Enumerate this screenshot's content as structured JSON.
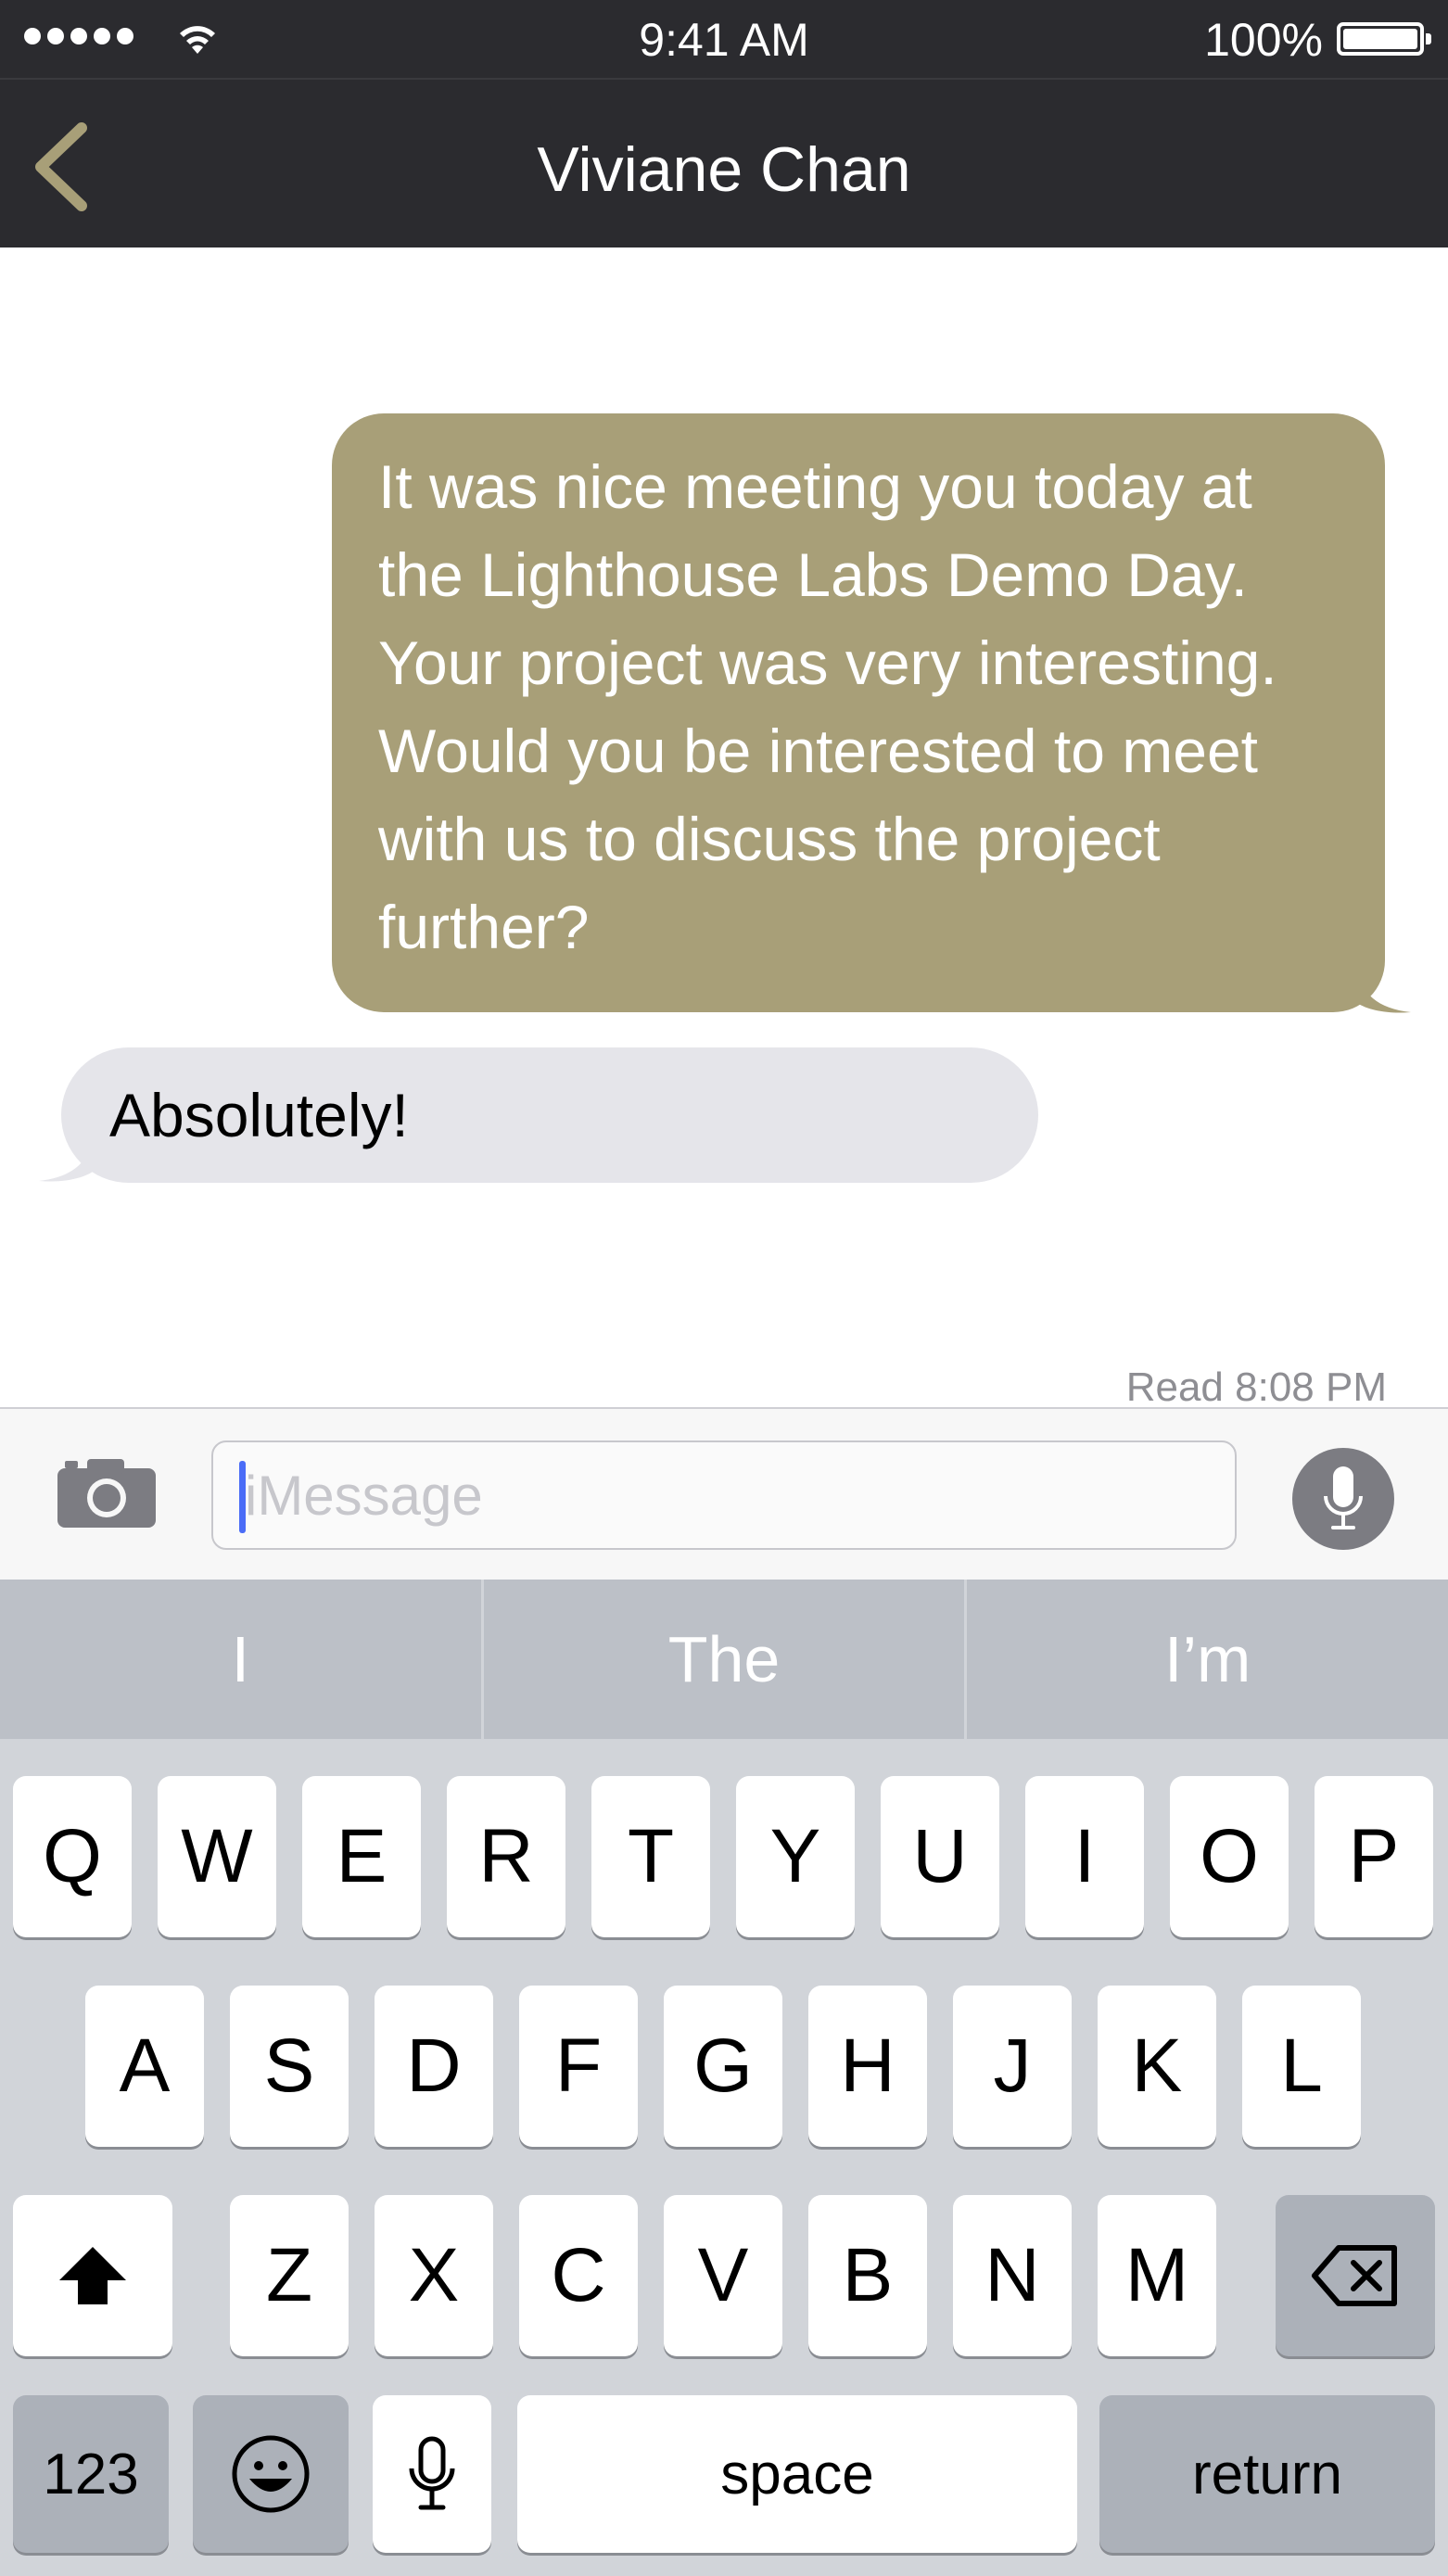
{
  "status_bar": {
    "time": "9:41 AM",
    "battery_percent": "100%",
    "signal_dots": 5,
    "battery_level": 1.0
  },
  "nav": {
    "title": "Viviane Chan",
    "back_icon": "chevron-left-icon",
    "accent_color": "#a89f78"
  },
  "messages": [
    {
      "direction": "outgoing",
      "text": "It was nice meeting you today at the Lighthouse Labs Demo Day. Your project was very interesting. Would you be interested to meet with us to discuss the project further?",
      "lines": [
        "It was nice meeting you today at",
        "the Lighthouse Labs Demo Day.",
        "Your project was very interesting.",
        "Would you be interested to meet",
        "with us to discuss the project",
        "further?"
      ],
      "color": "#a89f78"
    },
    {
      "direction": "incoming",
      "text": "Absolutely!",
      "color": "#e5e5ea"
    }
  ],
  "read_receipt": "Read 8:08 PM",
  "input": {
    "placeholder": "iMessage",
    "value": "",
    "camera_icon": "camera-icon",
    "mic_icon": "microphone-icon"
  },
  "keyboard": {
    "suggestions": [
      "I",
      "The",
      "I’m"
    ],
    "row1": [
      "Q",
      "W",
      "E",
      "R",
      "T",
      "Y",
      "U",
      "I",
      "O",
      "P"
    ],
    "row2": [
      "A",
      "S",
      "D",
      "F",
      "G",
      "H",
      "J",
      "K",
      "L"
    ],
    "row3": [
      "Z",
      "X",
      "C",
      "V",
      "B",
      "N",
      "M"
    ],
    "shift_icon": "shift-arrow-icon",
    "delete_icon": "backspace-icon",
    "numbers_label": "123",
    "emoji_icon": "emoji-icon",
    "dictation_icon": "microphone-icon",
    "space_label": "space",
    "return_label": "return"
  }
}
